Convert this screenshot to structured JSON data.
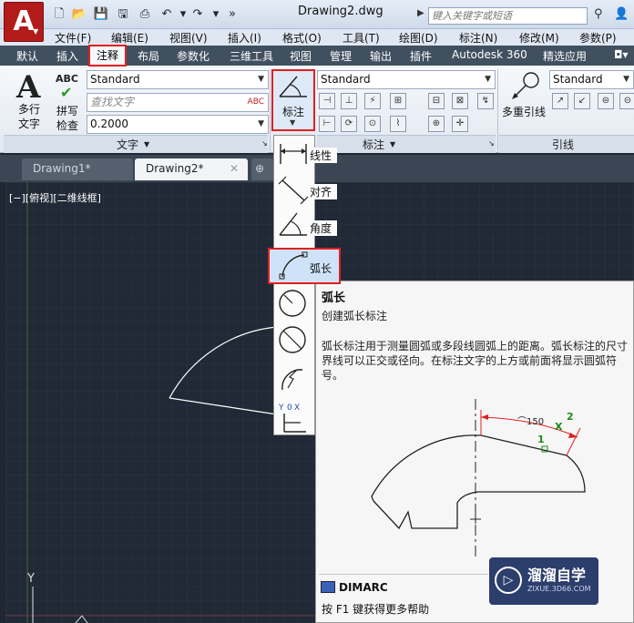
{
  "title": "Drawing2.dwg",
  "search_placeholder": "键入关键字或短语",
  "menus": [
    "文件(F)",
    "编辑(E)",
    "视图(V)",
    "插入(I)",
    "格式(O)",
    "工具(T)",
    "绘图(D)",
    "标注(N)",
    "修改(M)",
    "参数(P)"
  ],
  "ribbon_tabs": [
    "默认",
    "插入",
    "注释",
    "布局",
    "参数化",
    "三维工具",
    "视图",
    "管理",
    "输出",
    "插件",
    "Autodesk 360",
    "精选应用"
  ],
  "ribbon": {
    "multiline_text": "多行\n文字",
    "spell_check_abc": "ABC",
    "spell_check": "拼写\n检查",
    "text_style": "Standard",
    "find_text_placeholder": "查找文字",
    "text_height": "0.2000",
    "text_panel": "文字",
    "dimension_button": "标注",
    "dim_style": "Standard",
    "dim_panel": "标注",
    "mleader_style": "Standard",
    "mleader_button": "多重引线",
    "leader_panel": "引线"
  },
  "doc_tabs": [
    "Drawing1*",
    "Drawing2*"
  ],
  "viewport_label": "[−][俯视][二维线框]",
  "ucs_y": "Y",
  "dropdown": {
    "linear": "线性",
    "aligned": "对齐",
    "angular": "角度",
    "arclength": "弧长",
    "radius_partial": "半",
    "diameter_partial": "直",
    "jogged_partial": "折",
    "ordinate_partial": "坐",
    "ordinate_x": "X",
    "ordinate_y": "Y",
    "ordinate_zero": "0"
  },
  "tooltip": {
    "title": "弧长",
    "subtitle": "创建弧长标注",
    "description": "弧长标注用于测量圆弧或多段线圆弧上的距离。弧长标注的尺寸界线可以正交或径向。在标注文字的上方或前面将显示圆弧符号。",
    "illus_dim": "⌒150",
    "illus_p1": "1",
    "illus_p2": "2",
    "illus_x": "X",
    "command": "DIMARC",
    "help": "按 F1 键获得更多帮助"
  },
  "watermark": {
    "text": "溜溜自学",
    "url": "ZIXUE.3D66.COM"
  }
}
